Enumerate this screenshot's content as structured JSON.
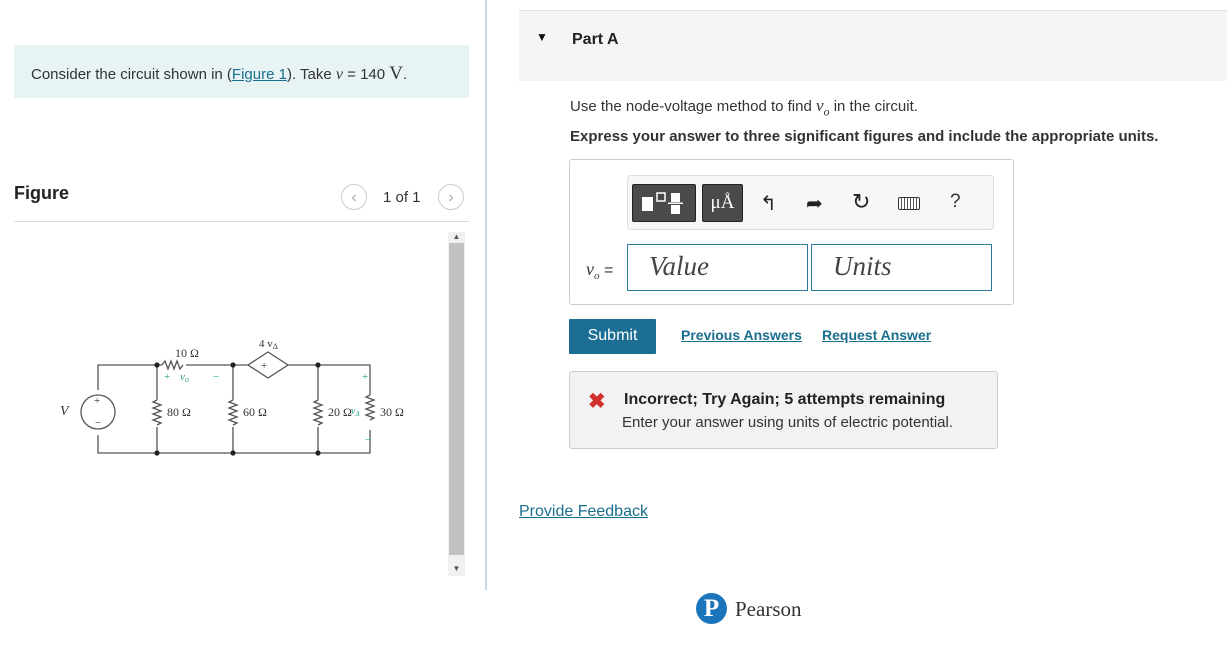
{
  "intro": {
    "prefix": "Consider the circuit shown in (",
    "figure_link": "Figure 1",
    "middle": "). Take ",
    "var": "v",
    "equals_value": " = 140 ",
    "unit": "V",
    "suffix": "."
  },
  "figure": {
    "title": "Figure",
    "counter": "1 of 1",
    "prev_icon": "chevron-left",
    "next_icon": "chevron-right"
  },
  "circuit": {
    "source_label": "V",
    "r1": "10 Ω",
    "vo_plus": "+",
    "vo_label": "v",
    "vo_sub": "o",
    "vo_minus": "−",
    "dep_source": "4 v",
    "dep_sub": "Δ",
    "dep_plus": "+",
    "r2": "80 Ω",
    "r3": "60 Ω",
    "r4": "20 Ω",
    "vdelta": "v",
    "vdelta_sub": "Δ",
    "r5": "30 Ω",
    "src_plus": "+",
    "src_minus": "−",
    "vd_plus": "+",
    "vd_minus": "−"
  },
  "part": {
    "title": "Part A",
    "question_prefix": "Use the node-voltage method to find ",
    "question_var": "v",
    "question_sub": "o",
    "question_suffix": " in the circuit.",
    "instruction": "Express your answer to three significant figures and include the appropriate units."
  },
  "toolbar": {
    "units_label": "μÅ",
    "undo_icon": "undo-arrow",
    "redo_icon": "redo-arrow",
    "reset_icon": "reset",
    "keyboard_icon": "keyboard",
    "help_label": "?"
  },
  "answer": {
    "var": "v",
    "sub": "o",
    "equals": " =",
    "value_placeholder": "Value",
    "units_placeholder": "Units"
  },
  "actions": {
    "submit": "Submit",
    "previous_answers": "Previous Answers",
    "request_answer": "Request Answer"
  },
  "feedback": {
    "title": "Incorrect; Try Again; 5 attempts remaining",
    "detail": "Enter your answer using units of electric potential.",
    "status_color": "#d0312d"
  },
  "footer": {
    "provide_feedback": "Provide Feedback",
    "brand": "Pearson",
    "brand_mark": "P",
    "brand_color": "#1b75bb"
  }
}
